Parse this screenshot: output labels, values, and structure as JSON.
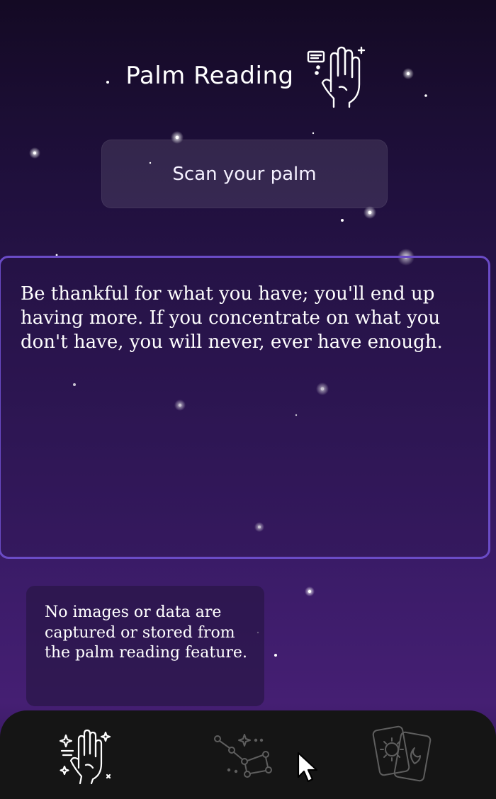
{
  "header": {
    "title": "Palm Reading",
    "icon": "palm-hand-icon"
  },
  "scan": {
    "label": "Scan your palm"
  },
  "reading": {
    "text": "Be thankful for what you have; you'll end up having more. If you concentrate on what you don't have, you will never, ever have enough."
  },
  "privacy": {
    "text": "No images or data are captured or stored from the palm reading feature."
  },
  "nav": {
    "items": [
      {
        "name": "palm-reading",
        "icon": "palm-hand-sparkle-icon",
        "active": true
      },
      {
        "name": "constellations",
        "icon": "constellation-icon",
        "active": false
      },
      {
        "name": "tarot",
        "icon": "tarot-cards-icon",
        "active": false
      }
    ]
  },
  "colors": {
    "accent_border": "#6a4bc6",
    "nav_background": "#151515",
    "inactive_icon": "#5e5e5e",
    "active_icon": "#ffffff"
  }
}
